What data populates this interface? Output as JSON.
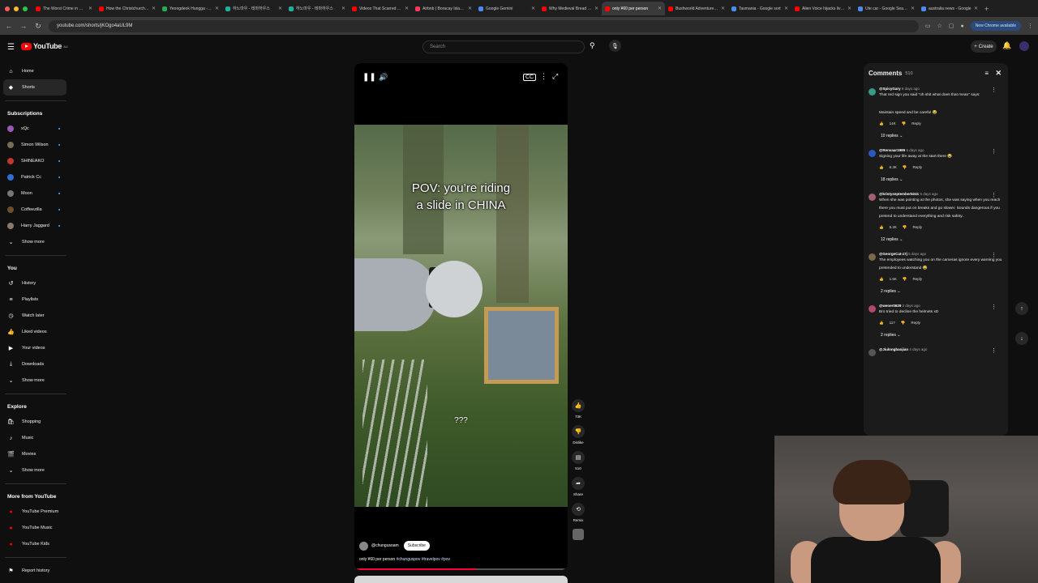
{
  "browser": {
    "tabs": [
      {
        "title": "The Worst Crime in New",
        "color": "#ff0000"
      },
      {
        "title": "How the Christchurch m",
        "color": "#ff0000"
      },
      {
        "title": "Yeongdeok Hungga - Nav",
        "color": "#20b050"
      },
      {
        "title": "하노마우 - 테마하우스",
        "color": "#20b0a0"
      },
      {
        "title": "하노마우 - 테마하우스",
        "color": "#20b0a0"
      },
      {
        "title": "Videos That Scarred Aust",
        "color": "#ff0000"
      },
      {
        "title": "Airbnb | Boracay Island -",
        "color": "#ff385c"
      },
      {
        "title": "Google Gemini",
        "color": "#4c8bf5"
      },
      {
        "title": "Why Medieval Bread Was",
        "color": "#ff0000"
      },
      {
        "title": "only ¥60 per person",
        "color": "#ff0000",
        "active": true
      },
      {
        "title": "Bushworld Adventures | A",
        "color": "#ff0000"
      },
      {
        "title": "Tasmania - Google sort",
        "color": "#4c8bf5"
      },
      {
        "title": "Alien Voice hijacks live T",
        "color": "#ff0000"
      },
      {
        "title": "Ute car - Google Search",
        "color": "#4c8bf5"
      },
      {
        "title": "australia news - Google",
        "color": "#4c8bf5"
      }
    ],
    "url": "youtube.com/shorts/jKOgo4aUL9M",
    "chrome_badge": "New Chrome available"
  },
  "header": {
    "logo": "YouTube",
    "logo_region": "AU",
    "search_placeholder": "Search",
    "create_label": "Create"
  },
  "sidebar": {
    "main": [
      {
        "label": "Home",
        "icon": "home-icon",
        "glyph": "⌂"
      },
      {
        "label": "Shorts",
        "icon": "shorts-icon",
        "glyph": "◆",
        "active": true
      }
    ],
    "subscriptions_title": "Subscriptions",
    "subscriptions": [
      {
        "label": "xQc",
        "color": "#9b59b6"
      },
      {
        "label": "Simon Wilson",
        "color": "#7a6a5a"
      },
      {
        "label": "SHINEAKO",
        "color": "#c0392b"
      },
      {
        "label": "Patrick Cc",
        "color": "#2e6fcf"
      },
      {
        "label": "Moon",
        "color": "#777777"
      },
      {
        "label": "Coffeezilla",
        "color": "#6b4f2a"
      },
      {
        "label": "Harry Jaggard",
        "color": "#8a7a6a"
      }
    ],
    "subs_show_more": "Show more",
    "you_title": "You",
    "you_items": [
      {
        "label": "History",
        "glyph": "↺"
      },
      {
        "label": "Playlists",
        "glyph": "≡"
      },
      {
        "label": "Watch later",
        "glyph": "◷"
      },
      {
        "label": "Liked videos",
        "glyph": "👍"
      },
      {
        "label": "Your videos",
        "glyph": "▶"
      },
      {
        "label": "Downloads",
        "glyph": "⤓"
      }
    ],
    "you_show_more": "Show more",
    "explore_title": "Explore",
    "explore_items": [
      {
        "label": "Shopping",
        "glyph": "🛍"
      },
      {
        "label": "Music",
        "glyph": "♪"
      },
      {
        "label": "Movies",
        "glyph": "🎬"
      }
    ],
    "explore_show_more": "Show more",
    "more_title": "More from YouTube",
    "more_items": [
      {
        "label": "YouTube Premium"
      },
      {
        "label": "YouTube Music"
      },
      {
        "label": "YouTube Kids"
      }
    ],
    "report_history": "Report history"
  },
  "short": {
    "overlay_text_line1": "POV: you’re riding",
    "overlay_text_line2": "a slide in CHINA",
    "mid_text": "???",
    "channel": "@chungusoam",
    "subscribe_label": "Subscribe",
    "caption_prefix": "only ¥60 per person",
    "caption_tags": "#chunguspov #travelpov #pov",
    "progress": 0.57
  },
  "actions": {
    "like_count": "73K",
    "dislike_label": "Dislike",
    "comments_count": "510",
    "share_label": "Share",
    "remix_label": "Remix"
  },
  "comments": {
    "title": "Comments",
    "count": "510",
    "items": [
      {
        "author": "@SpicyGary",
        "time": "6 days ago",
        "text1": "That red sign you said \"oh shit what does that mean\" says:",
        "text2": "",
        "text3": "Maintain speed and be careful 😂",
        "likes": "14K",
        "reply": "Reply",
        "replies": "10 replies",
        "color": "#3a9a8a"
      },
      {
        "author": "@Renvaar1989",
        "time": "6 days ago",
        "text1": "Signing your life away at the start there 😂",
        "likes": "6.3K",
        "reply": "Reply",
        "replies": "18 replies",
        "color": "#2a5abf"
      },
      {
        "author": "@kristyseptember5241",
        "time": "5 days ago",
        "text1": "When she was pointing at the photos, she was saying when you reach there you must put on breaks and go slower. Sounds dangerous if you pretend to understand everything and risk safety..",
        "likes": "5.2K",
        "reply": "Reply",
        "replies": "12 replies",
        "color": "#a06070"
      },
      {
        "author": "@GeorgeCat-z7j",
        "time": "5 days ago",
        "text1": "The employees watching you on the cameras ignore every warning you pretended to understand 😂",
        "likes": "1.5K",
        "reply": "Reply",
        "replies": "2 replies",
        "color": "#7a6a4a"
      },
      {
        "author": "@wener0629",
        "time": "2 days ago",
        "text1": "Bro tried to decline the helmets xD",
        "likes": "117",
        "reply": "Reply",
        "replies": "2 replies",
        "color": "#b04a6a"
      },
      {
        "author": "@Jiulongbaojian",
        "time": "4 days ago",
        "text1": "",
        "likes": "",
        "reply": "",
        "replies": "",
        "color": "#555555"
      }
    ]
  }
}
